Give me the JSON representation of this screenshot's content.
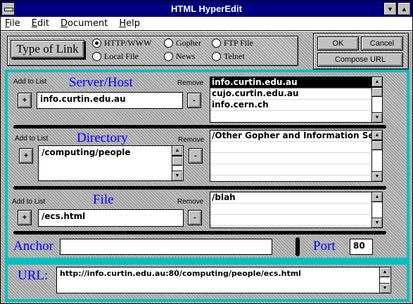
{
  "window": {
    "title": "HTML HyperEdit"
  },
  "menu": [
    "File",
    "Edit",
    "Document",
    "Help"
  ],
  "link_type": {
    "label": "Type of Link",
    "options": [
      "HTTP/WWW",
      "Gopher",
      "FTP File",
      "Local File",
      "News",
      "Telnet"
    ],
    "selected": "HTTP/WWW"
  },
  "buttons": {
    "ok": "OK",
    "cancel": "Cancel",
    "compose": "Compose URL"
  },
  "server": {
    "add_label": "Add to List",
    "title": "Server/Host",
    "remove_label": "Remove",
    "value": "info.curtin.edu.au",
    "list": [
      "info.curtin.edu.au",
      "cujo.curtin.edu.au",
      "info.cern.ch"
    ],
    "selected_index": 0
  },
  "directory": {
    "add_label": "Add to List",
    "title": "Directory",
    "remove_label": "Remove",
    "value": "/computing/people",
    "list": [
      "/Other Gopher and Information Ser"
    ]
  },
  "file": {
    "add_label": "Add to List",
    "title": "File",
    "remove_label": "Remove",
    "value": "/ecs.html",
    "list": [
      "/blah"
    ]
  },
  "anchor": {
    "label": "Anchor",
    "value": ""
  },
  "port": {
    "label": "Port",
    "value": "80"
  },
  "url": {
    "label": "URL:",
    "value": "http://info.curtin.edu.au:80/computing/people/ecs.html"
  },
  "glyphs": {
    "plus": "+",
    "minus": "-",
    "up": "▲",
    "down": "▼",
    "minimize": "▼",
    "maximize": "▲"
  },
  "colors": {
    "title_bar": "#000080",
    "accent": "#00c0c0",
    "label_blue": "#0000ff"
  }
}
